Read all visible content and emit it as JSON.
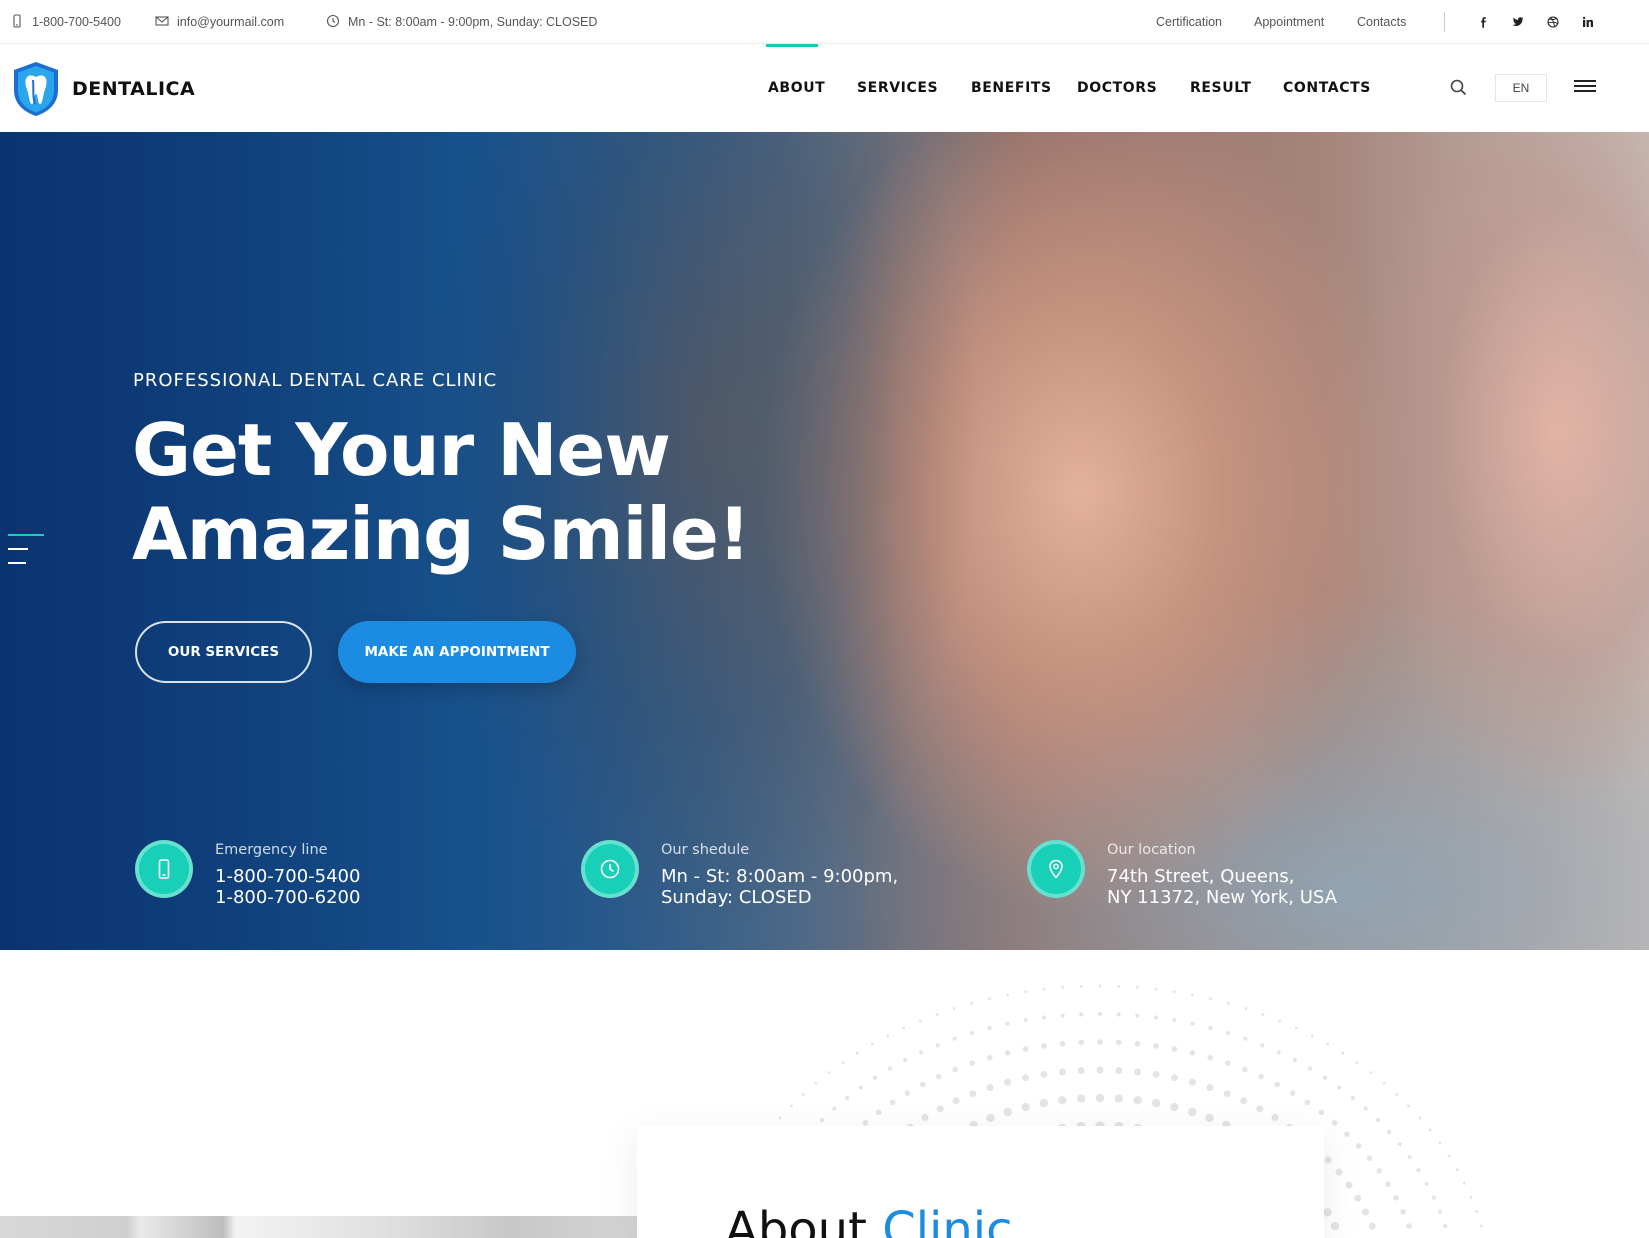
{
  "topbar": {
    "phone": "1-800-700-5400",
    "email": "info@yourmail.com",
    "hours": "Mn - St: 8:00am - 9:00pm, Sunday: CLOSED",
    "links": [
      "Certification",
      "Appointment",
      "Contacts"
    ],
    "social_icons": [
      "facebook-icon",
      "twitter-icon",
      "dribbble-icon",
      "linkedin-icon"
    ]
  },
  "header": {
    "brand": "DENTALICA",
    "nav": [
      "ABOUT",
      "SERVICES",
      "BENEFITS",
      "DOCTORS",
      "RESULT",
      "CONTACTS"
    ],
    "active_nav": "ABOUT",
    "lang": "EN"
  },
  "hero": {
    "kicker": "PROFESSIONAL DENTAL CARE CLINIC",
    "title_line1": "Get Your New",
    "title_line2": "Amazing Smile!",
    "btn_services": "OUR SERVICES",
    "btn_appointment": "MAKE AN APPOINTMENT",
    "info": [
      {
        "icon": "phone-icon",
        "label": "Emergency line",
        "line1": "1-800-700-5400",
        "line2": "1-800-700-6200"
      },
      {
        "icon": "clock-icon",
        "label": "Our shedule",
        "line1": "Mn - St: 8:00am - 9:00pm,",
        "line2": "Sunday: CLOSED"
      },
      {
        "icon": "location-pin-icon",
        "label": "Our location",
        "line1": "74th Street, Queens,",
        "line2": "NY 11372, New York, USA"
      }
    ]
  },
  "about": {
    "title_part1": "About",
    "title_part2": "Clinic"
  },
  "colors": {
    "accent_teal": "#18cfb7",
    "brand_blue": "#1c8ce3",
    "hero_blue": "#0d3f7a"
  }
}
